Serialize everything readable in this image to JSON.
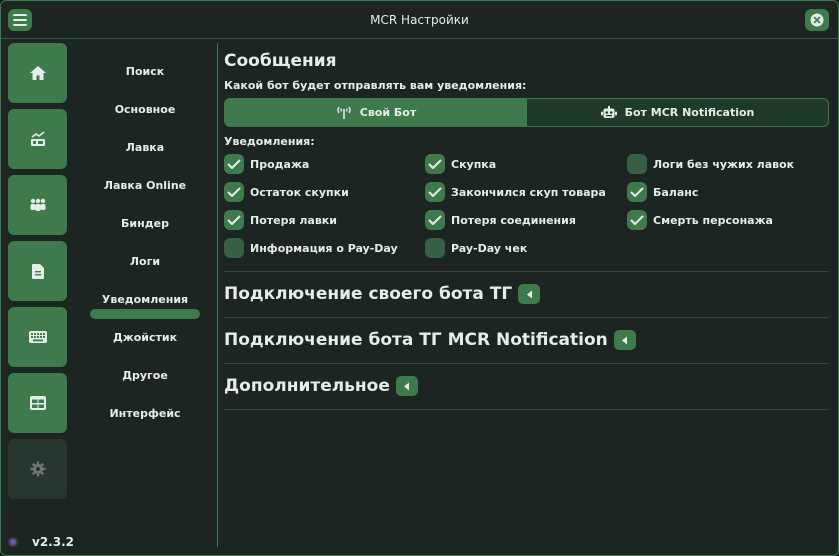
{
  "window": {
    "title": "MCR Настройки",
    "version": "v2.3.2"
  },
  "iconbar": [
    {
      "name": "home-icon"
    },
    {
      "name": "chart-icon"
    },
    {
      "name": "users-icon"
    },
    {
      "name": "document-icon"
    },
    {
      "name": "keyboard-icon"
    },
    {
      "name": "table-icon"
    },
    {
      "name": "gear-icon"
    }
  ],
  "categories": [
    "Поиск",
    "Основное",
    "Лавка",
    "Лавка Online",
    "Биндер",
    "Логи",
    "Уведомления",
    "Джойстик",
    "Другое",
    "Интерфейс"
  ],
  "active_category": "Уведомления",
  "messages": {
    "title": "Сообщения",
    "prompt": "Какой бот будет отправлять вам уведомления:",
    "bot_options": {
      "own": "Свой Бот",
      "mcr": "Бот MCR Notification"
    },
    "selected_bot": "Свой Бот",
    "notifications_label": "Уведомления:",
    "checkboxes": [
      {
        "label": "Продажа",
        "checked": true
      },
      {
        "label": "Скупка",
        "checked": true
      },
      {
        "label": "Логи без чужих лавок",
        "checked": false
      },
      {
        "label": "Остаток скупки",
        "checked": true
      },
      {
        "label": "Закончился скуп товара",
        "checked": true
      },
      {
        "label": "Баланс",
        "checked": true
      },
      {
        "label": "Потеря лавки",
        "checked": true
      },
      {
        "label": "Потеря соединения",
        "checked": true
      },
      {
        "label": "Смерть персонажа",
        "checked": true
      },
      {
        "label": "Информация о Pay-Day",
        "checked": false
      },
      {
        "label": "Pay-Day чек",
        "checked": false
      }
    ]
  },
  "sections": {
    "own_bot": "Подключение своего бота ТГ",
    "mcr_bot": "Подключение бота ТГ MCR Notification",
    "extra": "Дополнительное"
  },
  "colors": {
    "accent": "#3f7a4c",
    "background": "#1c2521",
    "border": "#3c7a4e"
  }
}
